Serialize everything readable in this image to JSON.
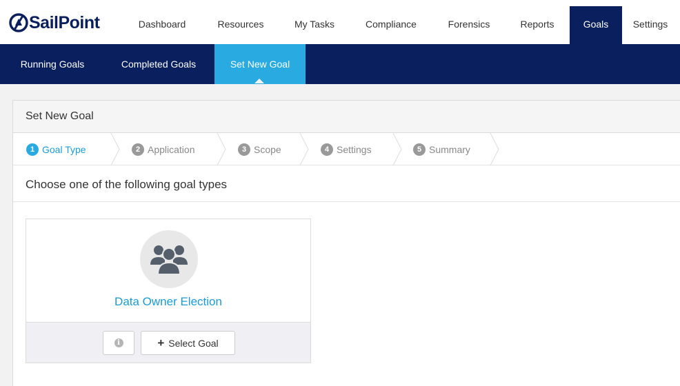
{
  "brand": {
    "logo_text": "SailPoint",
    "color": "#0b1f5c"
  },
  "main_nav": [
    {
      "label": "Dashboard",
      "active": false
    },
    {
      "label": "Resources",
      "active": false
    },
    {
      "label": "My Tasks",
      "active": false
    },
    {
      "label": "Compliance",
      "active": false
    },
    {
      "label": "Forensics",
      "active": false
    },
    {
      "label": "Reports",
      "active": false
    },
    {
      "label": "Goals",
      "active": true
    },
    {
      "label": "Settings",
      "active": false
    }
  ],
  "sub_nav": [
    {
      "label": "Running Goals",
      "active": false
    },
    {
      "label": "Completed Goals",
      "active": false
    },
    {
      "label": "Set New Goal",
      "active": true
    }
  ],
  "panel": {
    "title": "Set New Goal",
    "steps": [
      {
        "num": "1",
        "label": "Goal Type",
        "active": true
      },
      {
        "num": "2",
        "label": "Application",
        "active": false
      },
      {
        "num": "3",
        "label": "Scope",
        "active": false
      },
      {
        "num": "4",
        "label": "Settings",
        "active": false
      },
      {
        "num": "5",
        "label": "Summary",
        "active": false
      }
    ],
    "instruction": "Choose one of the following goal types"
  },
  "goal_card": {
    "icon": "users-icon",
    "title": "Data Owner Election",
    "info_icon": "info-icon",
    "select_label": "Select Goal",
    "select_icon": "plus-icon"
  },
  "colors": {
    "nav_dark": "#0a1f5e",
    "accent": "#29abe2",
    "link": "#1b9bd4"
  }
}
